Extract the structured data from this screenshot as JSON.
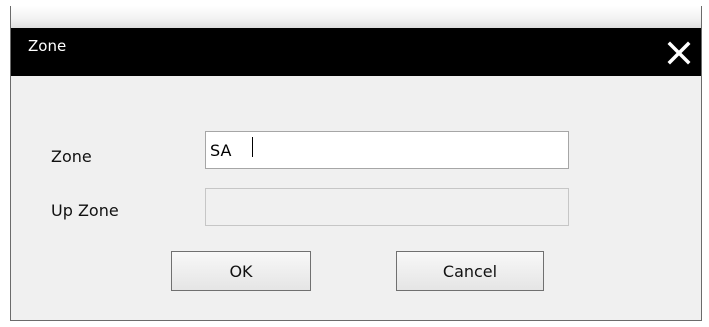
{
  "window": {
    "title": "Zone",
    "close_icon": "close-icon"
  },
  "form": {
    "zone_label": "Zone",
    "zone_value": "SA",
    "up_zone_label": "Up Zone",
    "up_zone_value": ""
  },
  "buttons": {
    "ok_label": "OK",
    "cancel_label": "Cancel"
  },
  "colors": {
    "titlebar": "#000000",
    "dialog_bg": "#f0f0f0",
    "title_text": "#ffffff"
  }
}
